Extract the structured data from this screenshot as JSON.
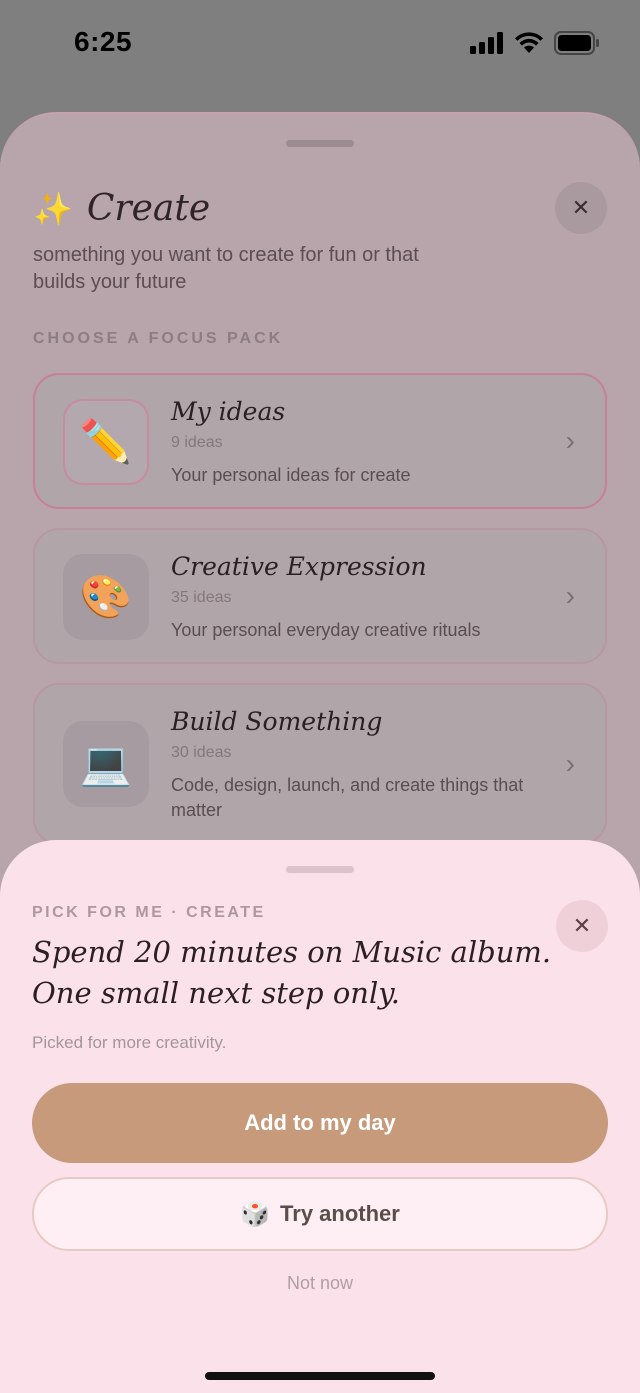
{
  "status_bar": {
    "time": "6:25"
  },
  "create_sheet": {
    "title": "Create",
    "subtitle": "something you want to create for fun or that builds your future",
    "section_label": "CHOOSE A FOCUS PACK",
    "close_symbol": "✕",
    "icons": {
      "title_icon": "sparkles-icon"
    },
    "packs": [
      {
        "name": "My ideas",
        "count": "9 ideas",
        "description": "Your personal ideas for create",
        "icon": "✏️",
        "icon_name": "pencil-icon",
        "selected": true
      },
      {
        "name": "Creative Expression",
        "count": "35 ideas",
        "description": "Your personal everyday creative rituals",
        "icon": "🎨",
        "icon_name": "palette-icon",
        "selected": false
      },
      {
        "name": "Build Something",
        "count": "30 ideas",
        "description": "Code, design, launch, and create things that matter",
        "icon": "💻",
        "icon_name": "laptop-icon",
        "selected": false
      }
    ]
  },
  "pick_sheet": {
    "label": "PICK FOR ME · CREATE",
    "suggestion": "Spend 20 minutes on Music album. One small next step only.",
    "note": "Picked for more creativity.",
    "primary_button": "Add to my day",
    "secondary_button": "Try another",
    "dismiss": "Not now",
    "close_symbol": "✕"
  },
  "colors": {
    "accent": "#c69a7b",
    "sheet_background": "#fbe2ea"
  }
}
